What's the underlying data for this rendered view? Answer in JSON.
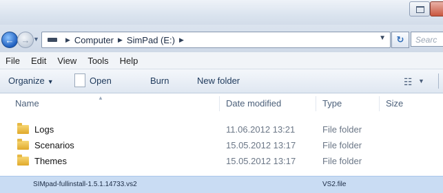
{
  "address_bar": {
    "crumbs": [
      "Computer",
      "SimPad (E:)"
    ],
    "search_placeholder": "Searc"
  },
  "menu": [
    "File",
    "Edit",
    "View",
    "Tools",
    "Help"
  ],
  "toolbar": {
    "organize": "Organize",
    "open": "Open",
    "burn": "Burn",
    "new_folder": "New folder"
  },
  "columns": {
    "name": "Name",
    "date_modified": "Date modified",
    "type": "Type",
    "size": "Size"
  },
  "rows": [
    {
      "name": "Logs",
      "date": "11.06.2012 13:21",
      "type": "File folder"
    },
    {
      "name": "Scenarios",
      "date": "15.05.2012 13:17",
      "type": "File folder"
    },
    {
      "name": "Themes",
      "date": "15.05.2012 13:17",
      "type": "File folder"
    }
  ],
  "selected_file": {
    "name": "SIMpad-fullinstall-1.5.1.14733.vs2",
    "type": "VS2.file"
  },
  "colors": {
    "selection": "#c9dcf3",
    "folder": "#f0c24b",
    "accent": "#1e395b"
  }
}
